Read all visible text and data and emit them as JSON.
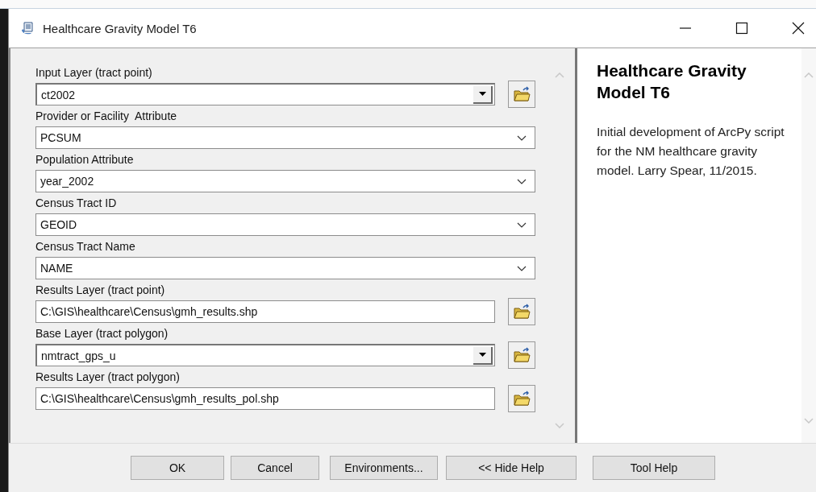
{
  "window": {
    "title": "Healthcare Gravity Model T6"
  },
  "fields": [
    {
      "label": "Input Layer (tract point)",
      "value": "ct2002",
      "kind": "combo"
    },
    {
      "label": "Provider or Facility  Attribute",
      "value": "PCSUM",
      "kind": "dropdown"
    },
    {
      "label": "Population Attribute",
      "value": "year_2002",
      "kind": "dropdown"
    },
    {
      "label": "Census Tract ID",
      "value": "GEOID",
      "kind": "dropdown"
    },
    {
      "label": "Census Tract Name",
      "value": "NAME",
      "kind": "dropdown"
    },
    {
      "label": "Results Layer (tract point)",
      "value": "C:\\GIS\\healthcare\\Census\\gmh_results.shp",
      "kind": "file"
    },
    {
      "label": "Base Layer (tract polygon)",
      "value": "nmtract_gps_u",
      "kind": "combo"
    },
    {
      "label": "Results Layer (tract polygon)",
      "value": "C:\\GIS\\healthcare\\Census\\gmh_results_pol.shp",
      "kind": "file"
    }
  ],
  "help": {
    "title": "Healthcare Gravity Model T6",
    "text": "Initial development of ArcPy script for the NM healthcare gravity model. Larry Spear, 11/2015."
  },
  "buttons": [
    {
      "label": "OK"
    },
    {
      "label": "Cancel"
    },
    {
      "label": "Environments..."
    },
    {
      "label": "<< Hide Help"
    }
  ],
  "help_button": {
    "label": "Tool Help"
  }
}
